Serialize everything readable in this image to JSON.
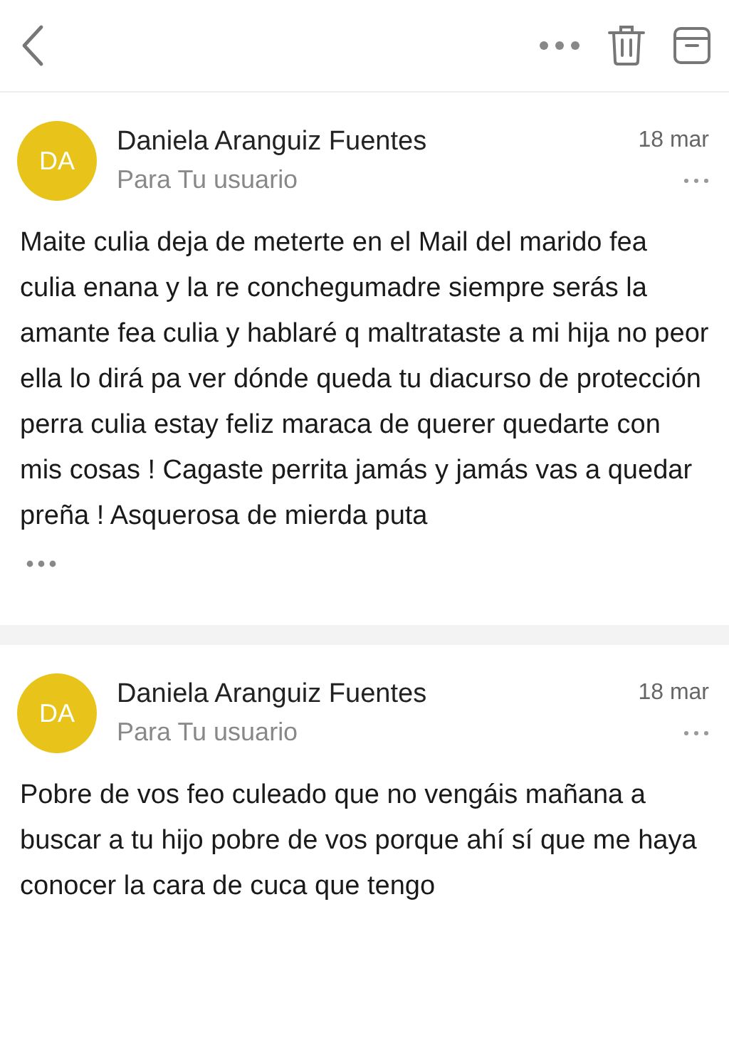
{
  "messages": [
    {
      "avatar": "DA",
      "sender": "Daniela Aranguiz Fuentes",
      "recipient": "Para Tu usuario",
      "date": "18 mar",
      "body": "Maite culia deja de meterte en el Mail del marido fea culia enana y la re conchegumadre siempre serás la amante fea culia y hablaré q maltrataste a mi hija no peor ella lo dirá pa ver dónde queda tu diacurso de protección perra culia estay feliz maraca de querer quedarte con mis cosas ! Cagaste perrita  jamás y jamás vas a quedar preña ! Asquerosa de mierda puta",
      "quoted_toggle": true
    },
    {
      "avatar": "DA",
      "sender": "Daniela Aranguiz Fuentes",
      "recipient": "Para Tu usuario",
      "date": "18 mar",
      "body": "Pobre de vos feo culeado que no vengáis mañana a buscar a tu hijo pobre de vos porque ahí sí que me haya conocer la cara de cuca que tengo",
      "quoted_toggle": false
    }
  ]
}
